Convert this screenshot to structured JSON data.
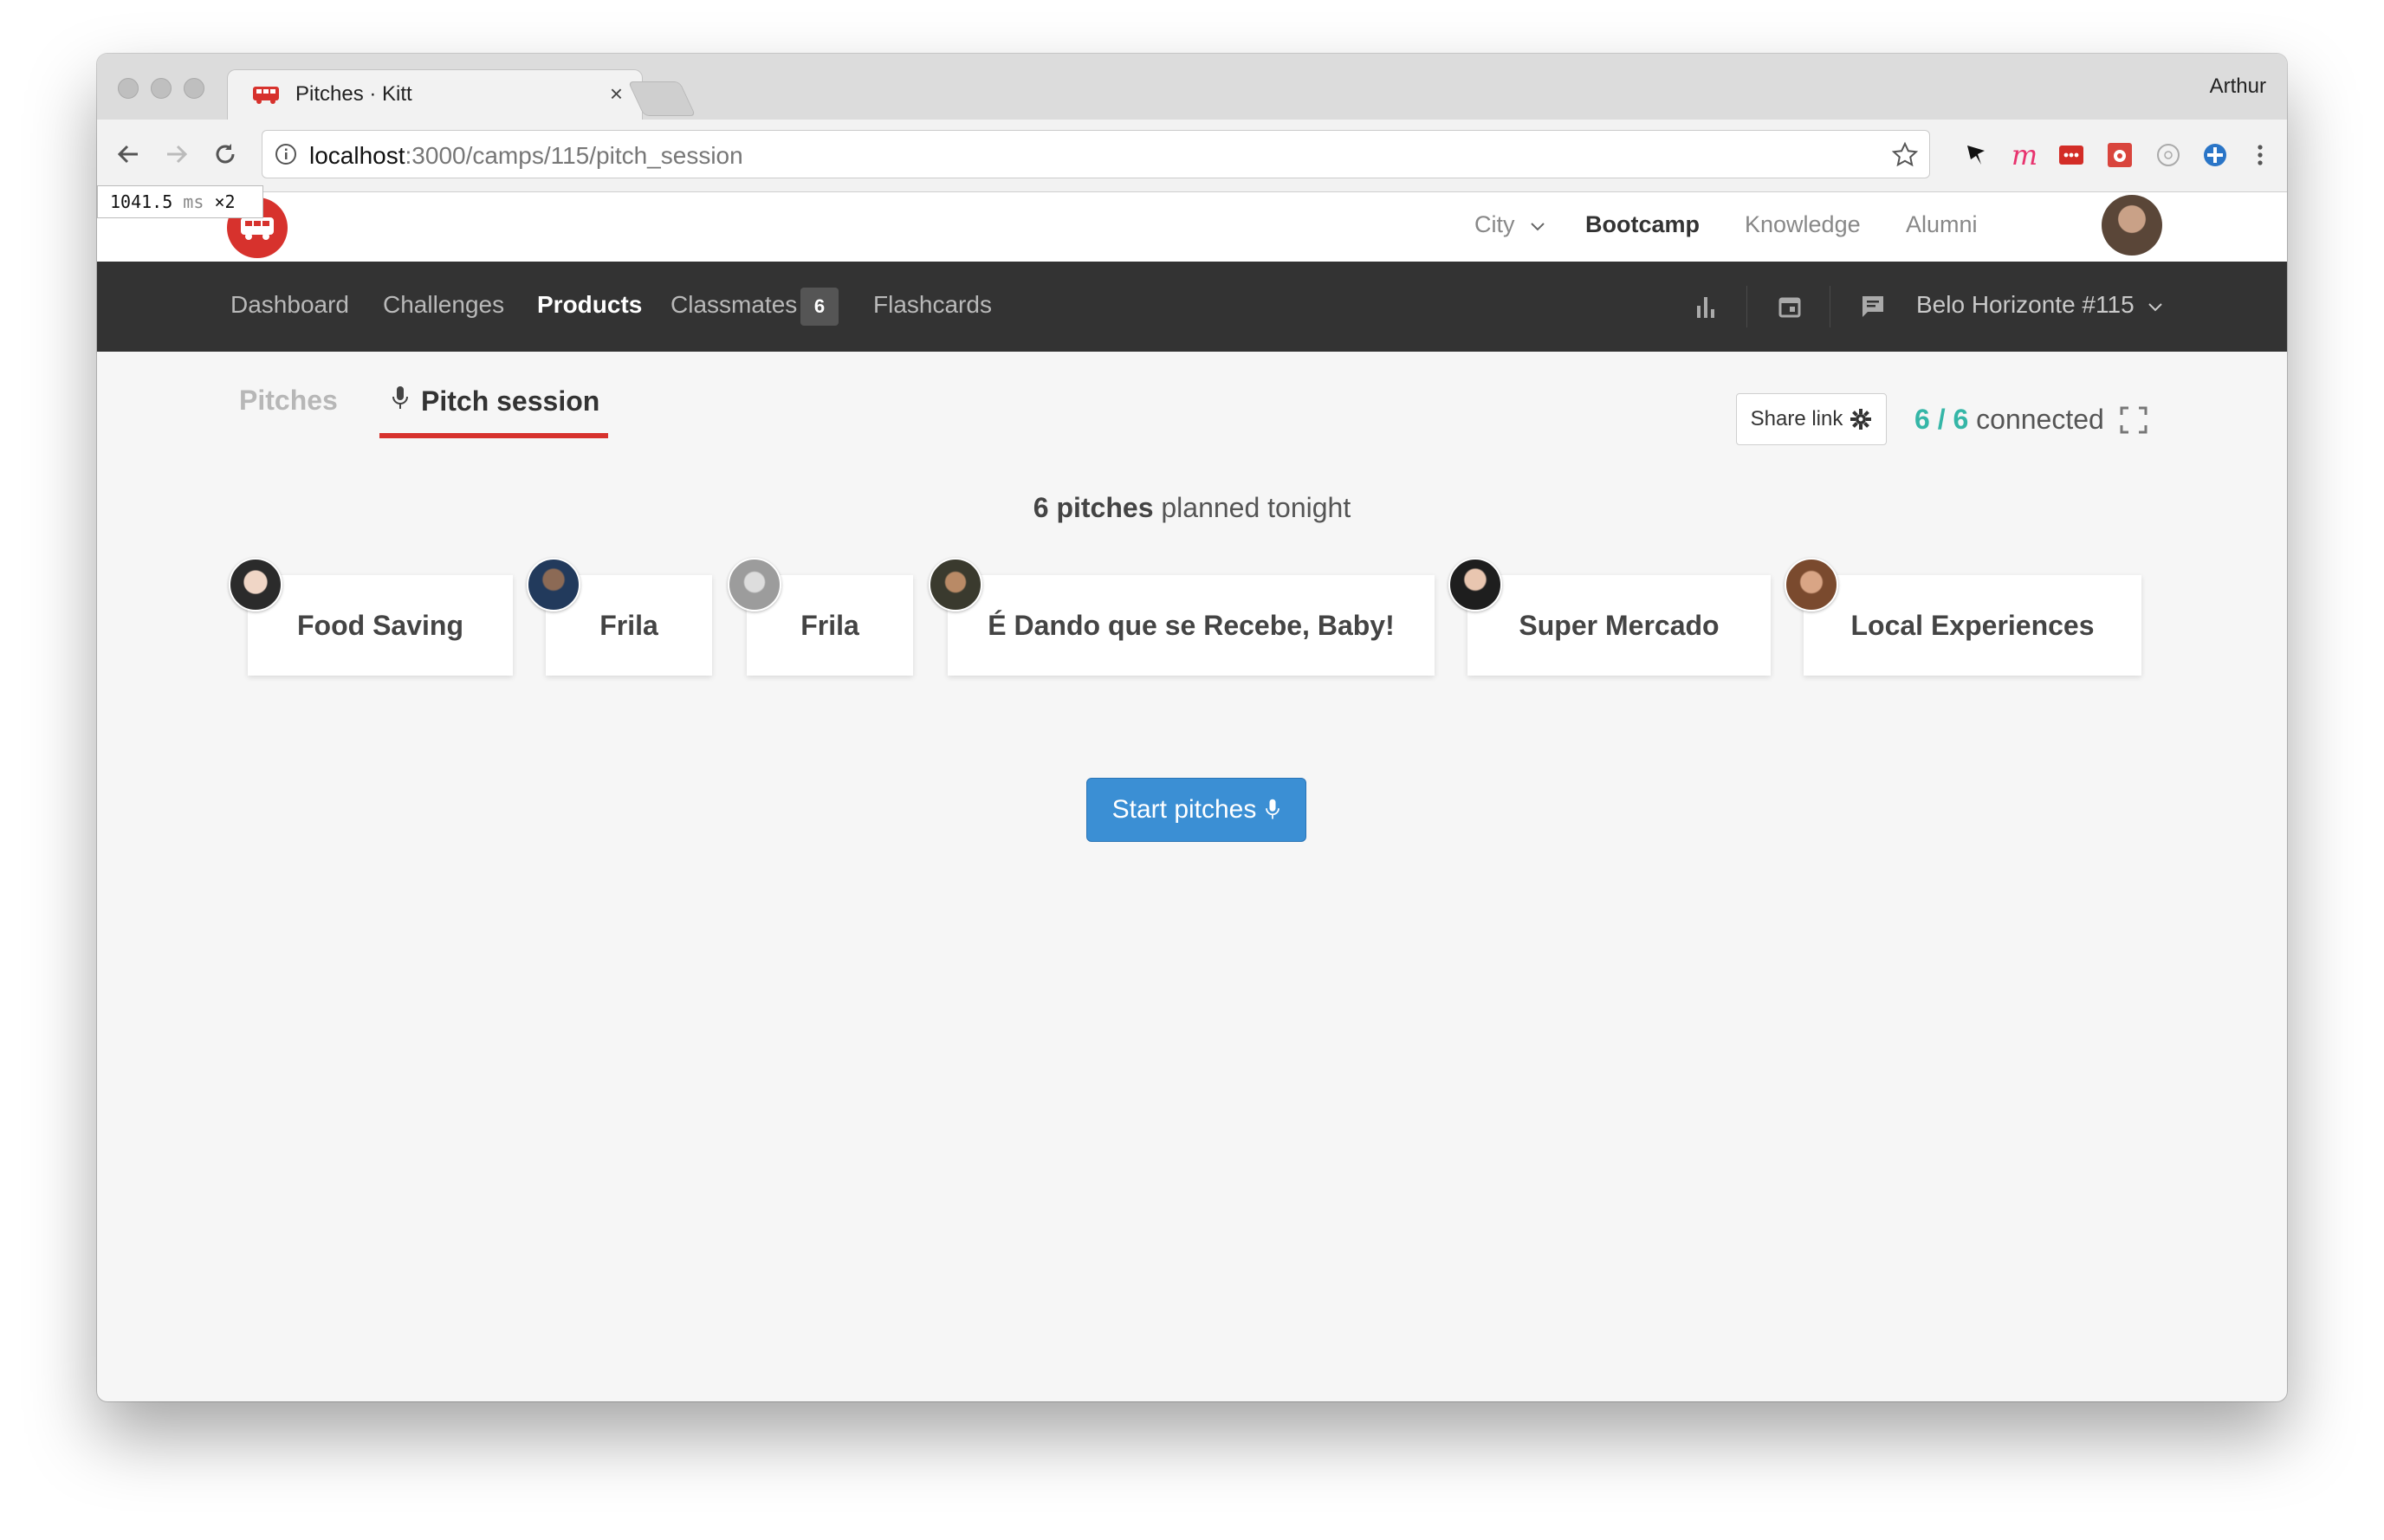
{
  "browser": {
    "tab_title": "Pitches · Kitt",
    "tab_close": "×",
    "profile_name": "Arthur",
    "url_host": "localhost",
    "url_path": ":3000/camps/115/pitch_session"
  },
  "perf_badge": {
    "value": "1041.5",
    "unit": "ms",
    "multiplier": "×2"
  },
  "header": {
    "nav": [
      {
        "label": "City"
      },
      {
        "label": "Bootcamp"
      },
      {
        "label": "Knowledge"
      },
      {
        "label": "Alumni"
      }
    ]
  },
  "navbar": {
    "items": [
      {
        "label": "Dashboard"
      },
      {
        "label": "Challenges"
      },
      {
        "label": "Products"
      },
      {
        "label": "Classmates"
      },
      {
        "label": "Flashcards"
      }
    ],
    "classmates_count": "6",
    "camp_selector": "Belo Horizonte #115"
  },
  "subtabs": {
    "pitches": "Pitches",
    "pitch_session": "Pitch session"
  },
  "session": {
    "share_label": "Share link",
    "connected_count": "6 / 6",
    "connected_label": " connected",
    "summary_count": "6 pitches",
    "summary_rest": " planned tonight",
    "start_label": "Start pitches"
  },
  "pitches": [
    {
      "title": "Food Saving"
    },
    {
      "title": "Frila"
    },
    {
      "title": "Frila"
    },
    {
      "title": "É Dando que se Recebe, Baby!"
    },
    {
      "title": "Super Mercado"
    },
    {
      "title": "Local Experiences"
    }
  ],
  "colors": {
    "brand_red": "#d7322d",
    "navbar_bg": "#333333",
    "connected_teal": "#35b6a7",
    "primary_blue": "#3b8fd4"
  },
  "icons": [
    "back-arrow-icon",
    "forward-arrow-icon",
    "reload-icon",
    "info-icon",
    "star-icon",
    "microphone-icon",
    "gear-icon",
    "fullscreen-icon",
    "bar-chart-icon",
    "calendar-icon",
    "chat-icon",
    "chevron-down-icon",
    "bus-logo-icon"
  ]
}
